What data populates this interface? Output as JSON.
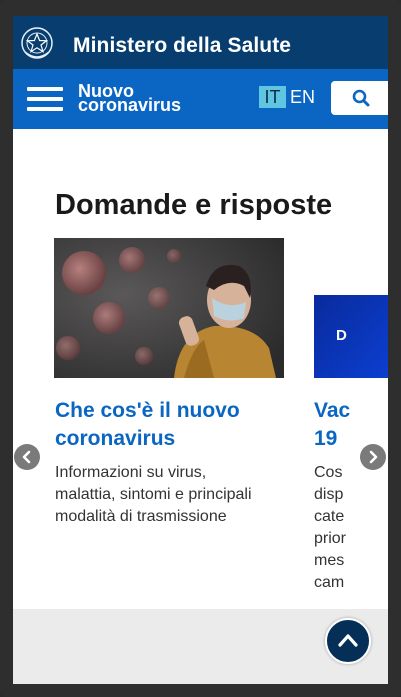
{
  "header": {
    "title": "Ministero della Salute",
    "emblem_icon": "italian-republic-emblem-icon"
  },
  "section_bar": {
    "title_line1": "Nuovo",
    "title_line2": "coronavirus",
    "lang_it": "IT",
    "lang_en": "EN",
    "menu_icon": "hamburger-menu-icon",
    "search_icon": "search-icon"
  },
  "main": {
    "heading": "Domande e risposte",
    "cards": [
      {
        "title_line1": "Che cos'è il nuovo",
        "title_line2": "coronavirus",
        "desc_line1": "Informazioni su virus,",
        "desc_line2": "malattia, sintomi e principali",
        "desc_line3": "modalità di trasmissione"
      },
      {
        "title_line1": "Vac",
        "title_line2": "19",
        "image_letter": "D",
        "desc_line1": "Cos",
        "desc_line2": "disp",
        "desc_line3": "cate",
        "desc_line4": "prior",
        "desc_line5": "mes",
        "desc_line6": "cam"
      }
    ],
    "prev_icon": "chevron-left-icon",
    "next_icon": "chevron-right-icon"
  },
  "footer": {
    "scroll_top_icon": "chevron-up-icon"
  },
  "colors": {
    "header_bg": "#083e6f",
    "section_bg": "#0b66c3",
    "accent_it": "#5ec6e0",
    "link": "#0b66c3"
  }
}
